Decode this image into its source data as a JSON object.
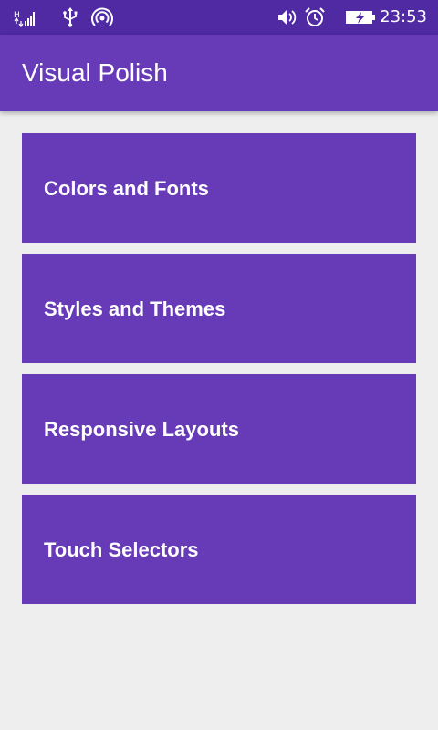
{
  "status_bar": {
    "time": "23:53",
    "icons": [
      "signal-icon",
      "usb-icon",
      "hotspot-icon",
      "volume-icon",
      "alarm-icon",
      "battery-charging-icon"
    ],
    "background": "#4f2aa3"
  },
  "app_bar": {
    "title": "Visual Polish",
    "background": "#673ab7"
  },
  "cards": [
    {
      "label": "Colors and Fonts"
    },
    {
      "label": "Styles and Themes"
    },
    {
      "label": "Responsive Layouts"
    },
    {
      "label": "Touch Selectors"
    }
  ],
  "colors": {
    "accent": "#673ab7",
    "page_background": "#eeeeee",
    "text_on_accent": "#ffffff"
  }
}
